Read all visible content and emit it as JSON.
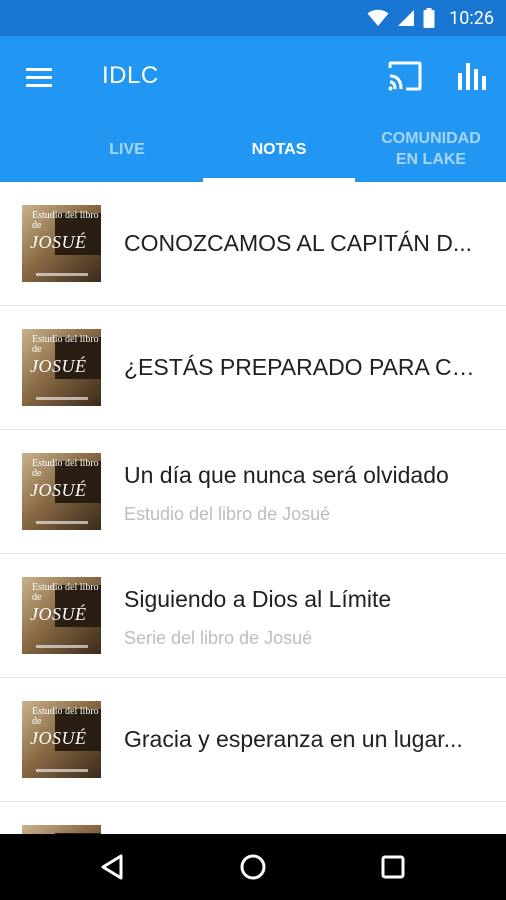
{
  "status_bar": {
    "time": "10:26",
    "icons": [
      "wifi-icon",
      "signal-icon",
      "battery-icon"
    ]
  },
  "app_bar": {
    "title": "IDLC",
    "icons": [
      "menu-icon",
      "cast-icon",
      "stats-icon"
    ],
    "colors": {
      "status": "#1976d2",
      "toolbar": "#2196f3"
    }
  },
  "tabs": [
    {
      "label": "LIVE",
      "active": false
    },
    {
      "label": "NOTAS",
      "active": true
    },
    {
      "label": "COMUNIDAD\nEN LAKE",
      "active": false
    }
  ],
  "list": {
    "thumb_text": {
      "line1": "Estudio del libro de",
      "line2": "JOSUÉ"
    },
    "items": [
      {
        "title": "CONOZCAMOS AL CAPITÁN D...",
        "subtitle": ""
      },
      {
        "title": "¿ESTÁS PREPARADO PARA CO...",
        "subtitle": ""
      },
      {
        "title": "Un día que nunca será olvidado",
        "subtitle": "Estudio del libro de Josué"
      },
      {
        "title": "Siguiendo a Dios al Límite",
        "subtitle": "Serie del libro de Josué"
      },
      {
        "title": "Gracia y esperanza en un lugar...",
        "subtitle": ""
      }
    ]
  },
  "nav_bar": {
    "icons": [
      "back-icon",
      "home-icon",
      "recents-icon"
    ]
  }
}
